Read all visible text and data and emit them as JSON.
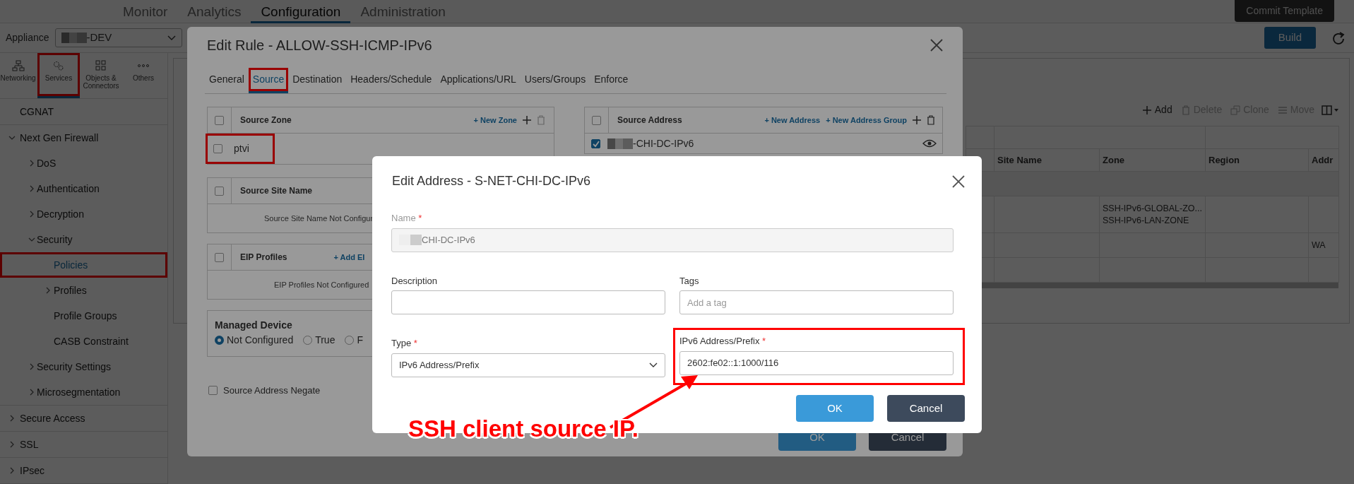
{
  "top_nav": {
    "tabs": [
      {
        "label": "Monitor",
        "selected": false
      },
      {
        "label": "Analytics",
        "selected": false
      },
      {
        "label": "Configuration",
        "selected": true
      },
      {
        "label": "Administration",
        "selected": false
      }
    ],
    "commit_button": "Commit Template"
  },
  "toolbar": {
    "appliance_label": "Appliance",
    "appliance_value": "-DEV",
    "build_button": "Build"
  },
  "sidebar": {
    "categories": [
      {
        "label": "Networking",
        "selected": false,
        "highlighted": false
      },
      {
        "label": "Services",
        "selected": true,
        "highlighted": true
      },
      {
        "label": "Objects & Connectors",
        "selected": false,
        "highlighted": false
      },
      {
        "label": "Others",
        "selected": false,
        "highlighted": false
      }
    ],
    "items": [
      {
        "label": "CGNAT",
        "selected": false,
        "highlighted": false
      },
      {
        "label": "Next Gen Firewall",
        "expanded": true,
        "selected": false,
        "highlighted": false,
        "children": [
          {
            "label": "DoS",
            "expanded": false,
            "selected": false,
            "highlighted": false
          },
          {
            "label": "Authentication",
            "expanded": false,
            "selected": false,
            "highlighted": false
          },
          {
            "label": "Decryption",
            "expanded": false,
            "selected": false,
            "highlighted": false
          },
          {
            "label": "Security",
            "expanded": true,
            "selected": false,
            "highlighted": false,
            "children": [
              {
                "label": "Policies",
                "selected": true,
                "highlighted": true
              },
              {
                "label": "Profiles",
                "expanded": false,
                "selected": false,
                "highlighted": false
              },
              {
                "label": "Profile Groups",
                "selected": false,
                "highlighted": false
              },
              {
                "label": "CASB Constraint",
                "selected": false,
                "highlighted": false
              }
            ]
          },
          {
            "label": "Security Settings",
            "expanded": false,
            "selected": false,
            "highlighted": false
          },
          {
            "label": "Microsegmentation",
            "expanded": false,
            "selected": false,
            "highlighted": false
          }
        ]
      },
      {
        "label": "Secure Access",
        "expanded": false,
        "selected": false,
        "highlighted": false
      },
      {
        "label": "SSL",
        "expanded": false,
        "selected": false,
        "highlighted": false
      },
      {
        "label": "IPsec",
        "expanded": false,
        "selected": false,
        "highlighted": false
      }
    ]
  },
  "policies_table": {
    "actions": [
      {
        "label": "Add",
        "disabled": false
      },
      {
        "label": "Delete",
        "disabled": true
      },
      {
        "label": "Clone",
        "disabled": true
      },
      {
        "label": "Move",
        "disabled": true
      }
    ],
    "columns": [
      "Site Name",
      "Zone",
      "Region",
      "Addr"
    ],
    "rows": [
      {
        "kind": "group"
      },
      {
        "kind": "data",
        "zone": [
          "SSH-IPv6-GLOBAL-ZO...",
          "SSH-IPv6-LAN-ZONE"
        ]
      },
      {
        "kind": "data",
        "address": "WA"
      },
      {
        "kind": "data"
      }
    ]
  },
  "edit_rule": {
    "title": "Edit Rule - ALLOW-SSH-ICMP-IPv6",
    "tabs": [
      {
        "label": "General",
        "selected": false,
        "highlighted": false
      },
      {
        "label": "Source",
        "selected": true,
        "highlighted": true
      },
      {
        "label": "Destination",
        "selected": false,
        "highlighted": false
      },
      {
        "label": "Headers/Schedule",
        "selected": false,
        "highlighted": false
      },
      {
        "label": "Applications/URL",
        "selected": false,
        "highlighted": false
      },
      {
        "label": "Users/Groups",
        "selected": false,
        "highlighted": false
      },
      {
        "label": "Enforce",
        "selected": false,
        "highlighted": false
      }
    ],
    "source_zone": {
      "header": "Source Zone",
      "header_checked": false,
      "link": "+ New Zone",
      "rows": [
        {
          "label": "ptvi",
          "checked": false,
          "highlighted": true
        }
      ]
    },
    "source_site": {
      "header": "Source Site Name",
      "header_checked": false,
      "empty_text": "Source Site Name Not Configur"
    },
    "eip_profiles": {
      "header": "EIP Profiles",
      "header_checked": false,
      "link": "+ Add EI",
      "empty_text": "EIP Profiles Not Configured"
    },
    "managed_device": {
      "label": "Managed Device",
      "options": [
        {
          "label": "Not Configured",
          "selected": true
        },
        {
          "label": "True",
          "selected": false
        },
        {
          "label": "F",
          "selected": false
        }
      ]
    },
    "negate": {
      "label": "Source Address Negate",
      "checked": false
    },
    "source_address": {
      "header": "Source Address",
      "header_checked": false,
      "links": [
        "+ New Address",
        "+ New Address Group"
      ],
      "rows": [
        {
          "label": "-CHI-DC-IPv6",
          "checked": true
        }
      ]
    },
    "buttons": [
      {
        "label": "OK",
        "kind": "primary"
      },
      {
        "label": "Cancel",
        "kind": "secondary"
      }
    ]
  },
  "edit_address": {
    "title": "Edit Address - S-NET-CHI-DC-IPv6",
    "fields": [
      {
        "kind": "text",
        "label": "Name",
        "required_mark": "*",
        "disabled": true,
        "value": "CHI-DC-IPv6",
        "highlighted": false
      },
      {
        "kind": "text",
        "label": "Description",
        "disabled": false,
        "highlighted": false
      },
      {
        "kind": "tags",
        "label": "Tags",
        "disabled": false,
        "placeholder": "Add a tag",
        "highlighted": false
      },
      {
        "kind": "select",
        "label": "Type",
        "required_mark": "*",
        "disabled": false,
        "value": "IPv6 Address/Prefix",
        "highlighted": false
      },
      {
        "kind": "text",
        "label": "IPv6 Address/Prefix",
        "required_mark": "*",
        "disabled": false,
        "value": "2602:fe02::1:1000/116",
        "highlighted": true
      }
    ],
    "buttons": [
      {
        "label": "OK",
        "kind": "primary"
      },
      {
        "label": "Cancel",
        "kind": "secondary"
      }
    ]
  },
  "annotation": {
    "caption": "SSH client source IP."
  }
}
